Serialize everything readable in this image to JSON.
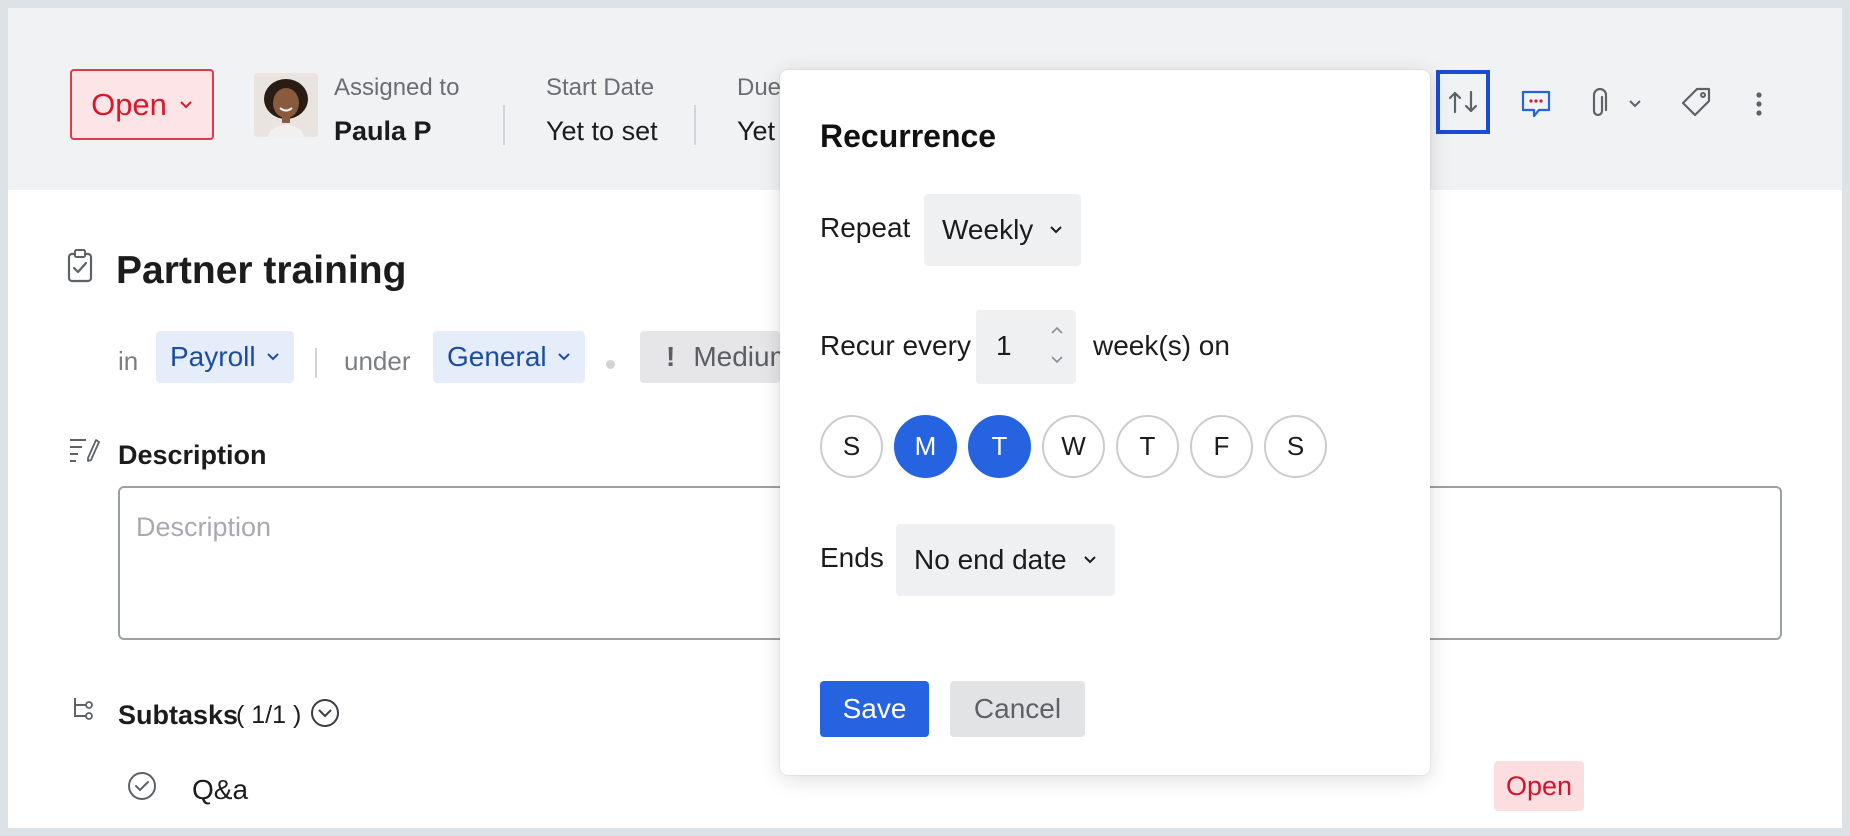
{
  "header": {
    "status": "Open",
    "assigned_label": "Assigned to",
    "assigned_value": "Paula P",
    "start_label": "Start Date",
    "start_value": "Yet to set",
    "due_label": "Due",
    "due_value": "Yet"
  },
  "task": {
    "title": "Partner training",
    "in_label": "in",
    "project": "Payroll",
    "under_label": "under",
    "list": "General",
    "priority": "Medium"
  },
  "description": {
    "label": "Description",
    "placeholder": "Description"
  },
  "subtasks": {
    "label": "Subtasks",
    "count": "( 1/1 )",
    "items": [
      {
        "title": "Q&a",
        "status": "Open"
      }
    ]
  },
  "recurrence": {
    "title": "Recurrence",
    "repeat_label": "Repeat",
    "repeat_value": "Weekly",
    "recur_every_label": "Recur every",
    "recur_every_value": "1",
    "unit_label": "week(s) on",
    "days": [
      {
        "label": "S",
        "selected": false
      },
      {
        "label": "M",
        "selected": true
      },
      {
        "label": "T",
        "selected": true
      },
      {
        "label": "W",
        "selected": false
      },
      {
        "label": "T",
        "selected": false
      },
      {
        "label": "F",
        "selected": false
      },
      {
        "label": "S",
        "selected": false
      }
    ],
    "ends_label": "Ends",
    "ends_value": "No end date",
    "save_label": "Save",
    "cancel_label": "Cancel"
  },
  "toolbar": {
    "icons": [
      "recurrence-icon",
      "comment-icon",
      "attachment-icon",
      "chevron-down-icon",
      "tag-icon",
      "more-vertical-icon"
    ]
  },
  "colors": {
    "accent": "#2563e0",
    "status_red": "#d8192c",
    "focus_outline": "#1a4bd6"
  }
}
